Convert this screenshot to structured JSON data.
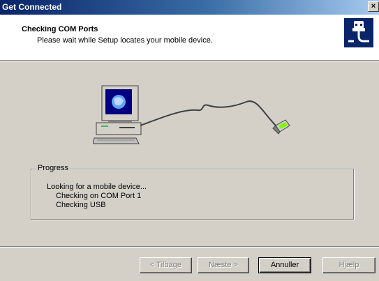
{
  "window": {
    "title": "Get Connected",
    "close_glyph": "×"
  },
  "header": {
    "title": "Checking COM Ports",
    "subtitle": "Please wait while Setup locates your mobile device.",
    "icon": "device-connector-icon"
  },
  "illustration": {
    "icons": [
      "desktop-computer-icon",
      "sync-cable-icon",
      "mobile-device-icon"
    ]
  },
  "progress": {
    "label": "Progress",
    "lines": [
      "Looking for a mobile device...",
      "Checking on COM Port 1",
      "Checking USB"
    ]
  },
  "buttons": {
    "back": "< Tilbage",
    "next": "Næste >",
    "cancel": "Annuller",
    "help": "Hjælp"
  },
  "colors": {
    "titlebar_start": "#0a246a",
    "titlebar_end": "#a6caf0",
    "dialog_bg": "#d4d0c8"
  }
}
